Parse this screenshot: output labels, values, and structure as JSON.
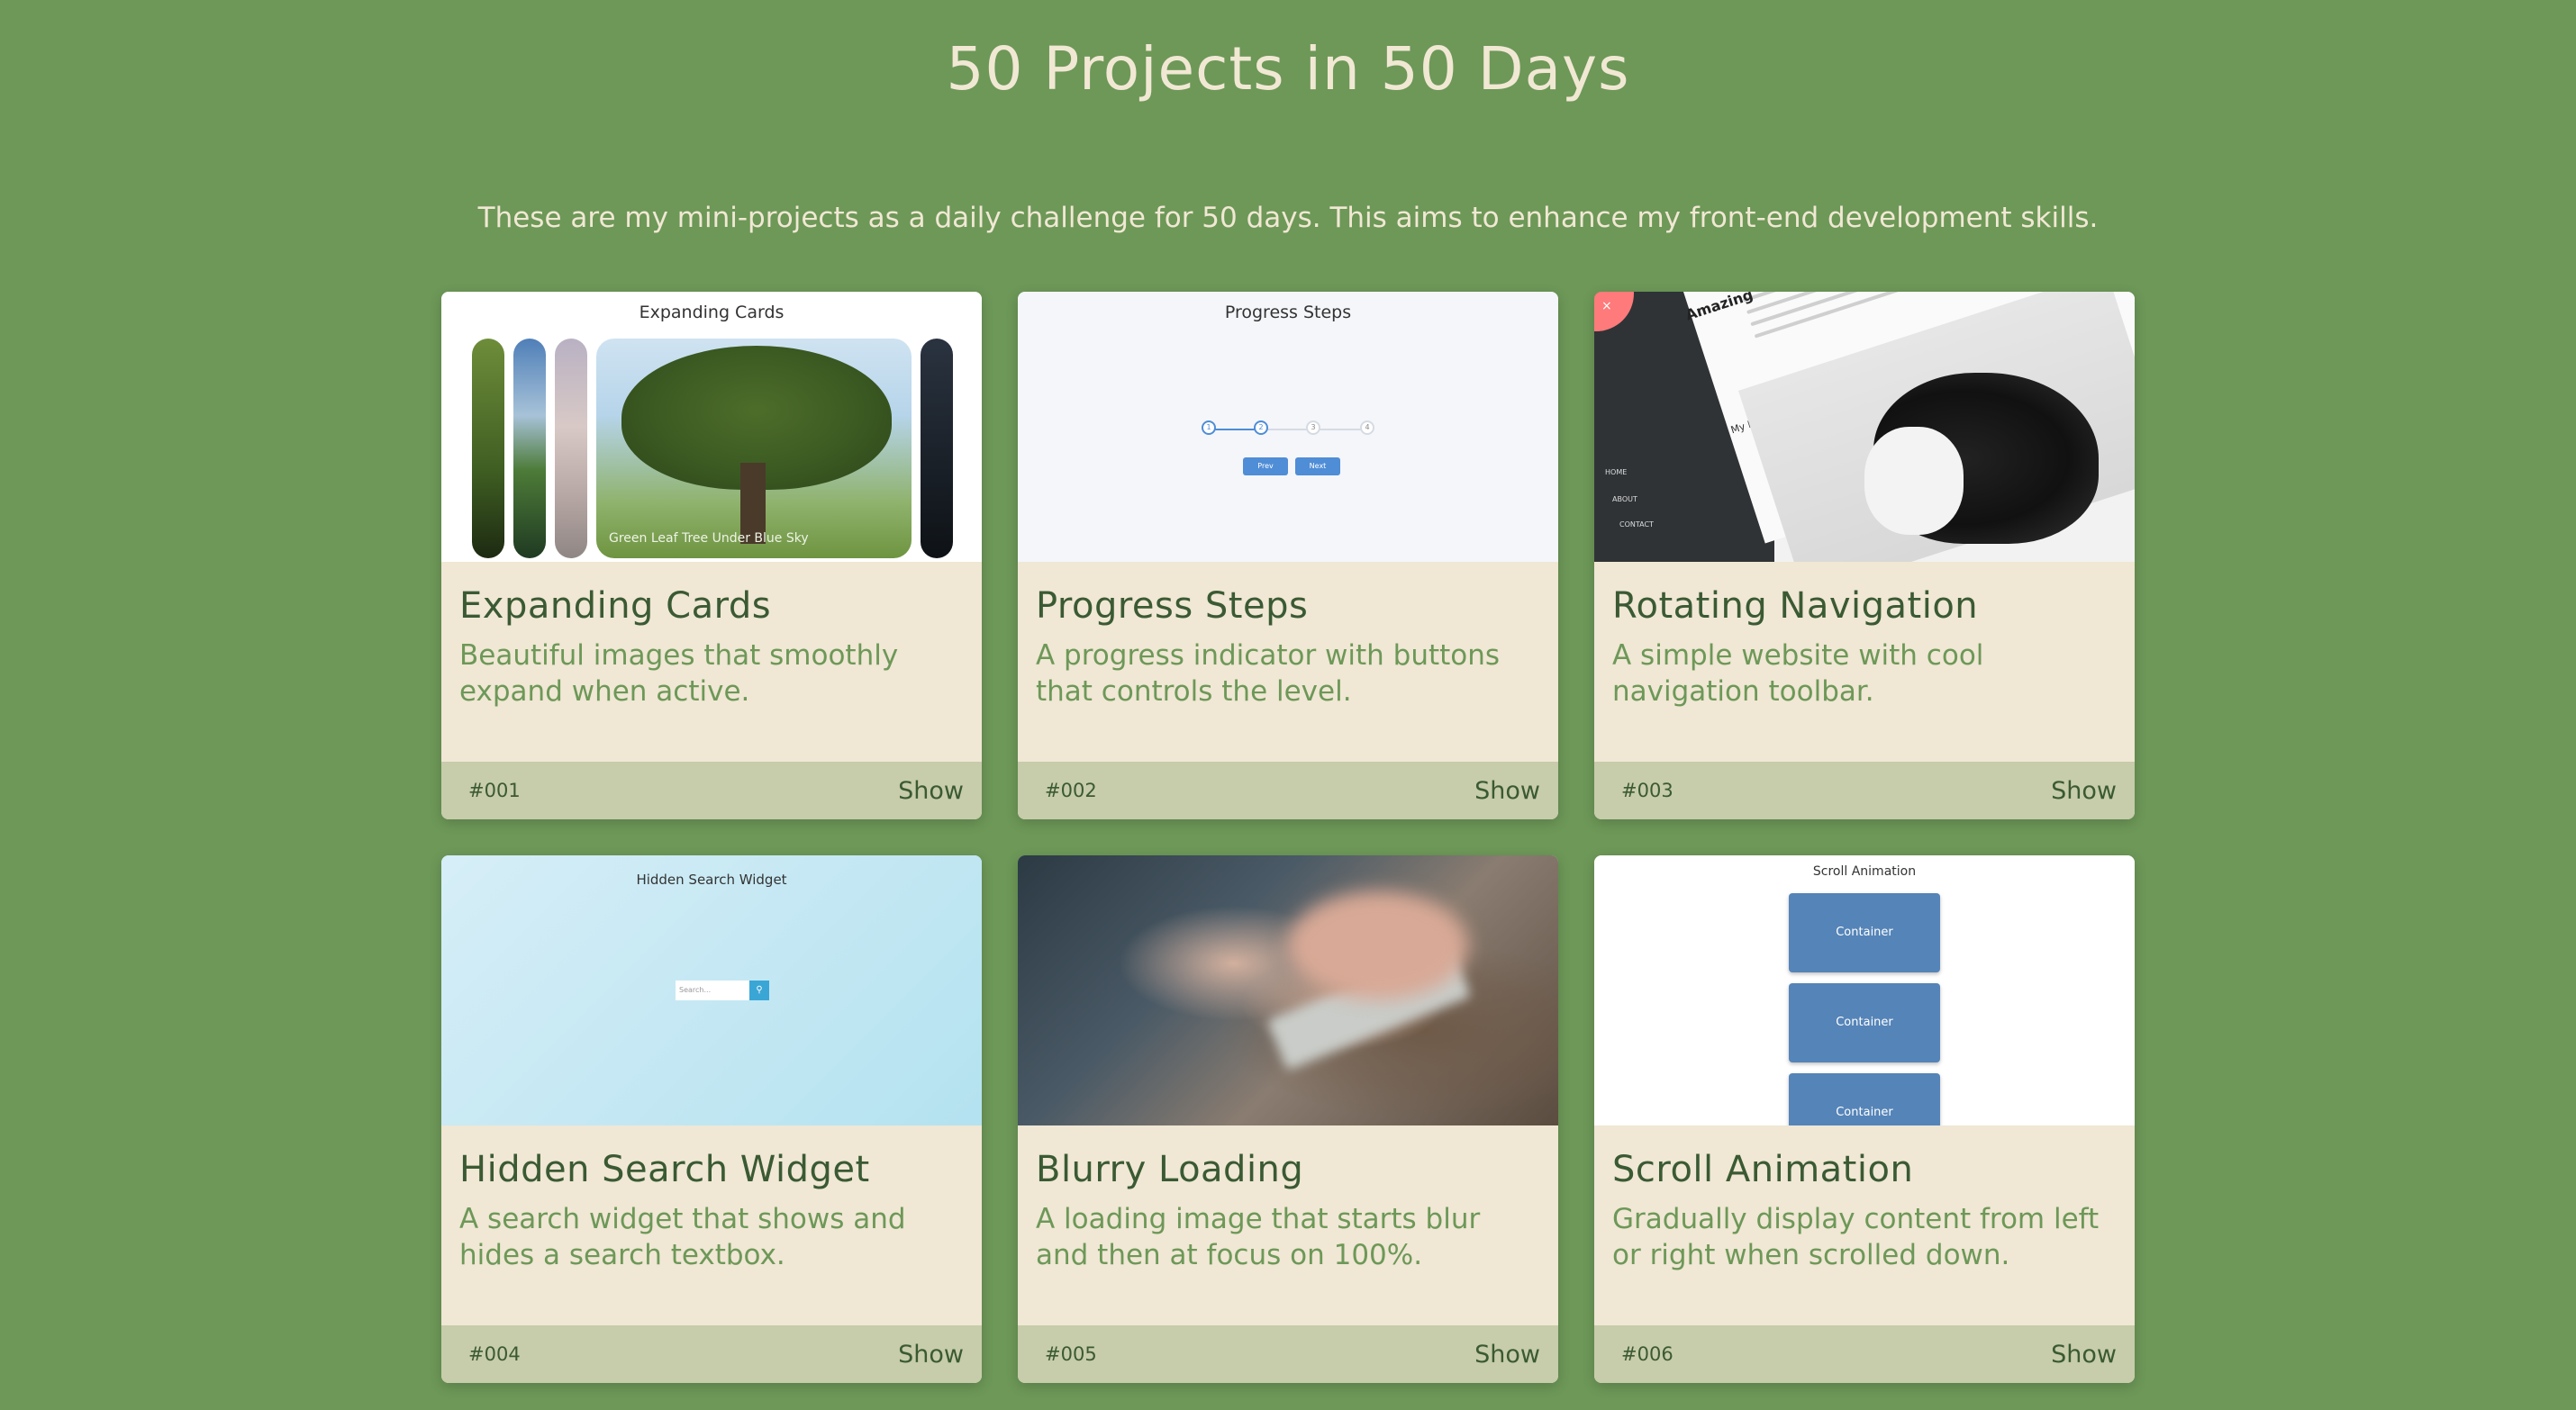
{
  "header": {
    "title": "50 Projects in 50 Days",
    "subtitle": "These are my mini-projects as a daily challenge for 50 days. This aims to enhance my front-end development skills."
  },
  "colors": {
    "background": "#6d9858",
    "card_body": "#f0e7d4",
    "card_footer": "#c7ccaa",
    "title_text": "#3a5a33",
    "header_text": "#f1e8d4"
  },
  "projects": [
    {
      "title": "Expanding Cards",
      "description": "Beautiful images that smoothly expand when active.",
      "number": "#001",
      "show_label": "Show",
      "thumb": {
        "heading": "Expanding Cards",
        "caption": "Green Leaf Tree Under Blue Sky"
      }
    },
    {
      "title": "Progress Steps",
      "description": "A progress indicator with buttons that controls the level.",
      "number": "#002",
      "show_label": "Show",
      "thumb": {
        "heading": "Progress Steps",
        "steps": [
          "1",
          "2",
          "3",
          "4"
        ],
        "prev_label": "Prev",
        "next_label": "Next"
      }
    },
    {
      "title": "Rotating Navigation",
      "description": "A simple website with cool navigation toolbar.",
      "number": "#003",
      "show_label": "Show",
      "thumb": {
        "heading": "Amazing",
        "subheading": "My Dream Dog",
        "nav_items": [
          "HOME",
          "ABOUT",
          "CONTACT"
        ],
        "close_glyph": "×"
      }
    },
    {
      "title": "Hidden Search Widget",
      "description": "A search widget that shows and hides a search textbox.",
      "number": "#004",
      "show_label": "Show",
      "thumb": {
        "heading": "Hidden Search Widget",
        "search_placeholder": "Search..."
      }
    },
    {
      "title": "Blurry Loading",
      "description": "A loading image that starts blur and then at focus on 100%.",
      "number": "#005",
      "show_label": "Show",
      "thumb": {}
    },
    {
      "title": "Scroll Animation",
      "description": "Gradually display content from left or right when scrolled down.",
      "number": "#006",
      "show_label": "Show",
      "thumb": {
        "heading": "Scroll Animation",
        "box_label": "Container"
      }
    }
  ]
}
